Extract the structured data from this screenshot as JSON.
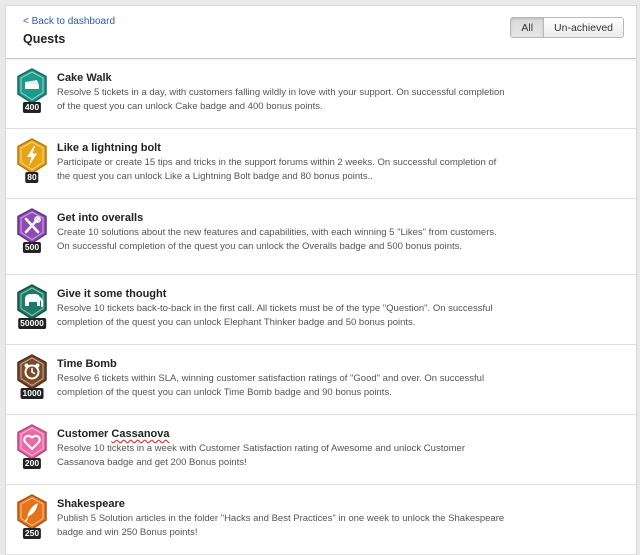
{
  "header": {
    "back_link": "< Back to dashboard",
    "title": "Quests",
    "filters": [
      {
        "label": "All",
        "active": true
      },
      {
        "label": "Un-achieved",
        "active": false
      }
    ]
  },
  "quests": [
    {
      "title": "Cake Walk",
      "title_tail": "",
      "points": "400",
      "icon": "cake-icon",
      "color": "#1f9a8a",
      "description": "Resolve 5 tickets in a day, with customers falling wildly in love with your support. On successful completion of the quest you can unlock Cake badge and 400 bonus points."
    },
    {
      "title": "Like a lightning bolt",
      "title_tail": "",
      "points": "80",
      "icon": "lightning-icon",
      "color": "#e8a317",
      "description": "Participate or create 15 tips and tricks in the support forums within 2 weeks. On successful completion of the quest you can unlock Like a Lightning Bolt badge and 80 bonus points.."
    },
    {
      "title": "Get into overalls",
      "title_tail": "",
      "points": "500",
      "icon": "tools-icon",
      "color": "#8e4bb5",
      "description": "Create 10 solutions about the new features and capabilities, with each winning 5 \"Likes\" from customers. On successful completion of the quest you can unlock the Overalls badge and 500 bonus points."
    },
    {
      "title": "Give it some thought",
      "title_tail": "",
      "points": "50000",
      "icon": "elephant-icon",
      "color": "#1d7a67",
      "description": "Resolve 10 tickets back-to-back in the first call. All tickets must be of the type \"Question\". On successful completion of the quest you can unlock Elephant Thinker badge and 50 bonus points."
    },
    {
      "title": "Time Bomb",
      "title_tail": "",
      "points": "1000",
      "icon": "alarm-clock-icon",
      "color": "#7a4a2a",
      "description": "Resolve 6 tickets within SLA, winning customer satisfaction ratings of \"Good\" and over. On successful completion of the quest you can unlock Time Bomb badge and 90 bonus points."
    },
    {
      "title": "Customer ",
      "title_tail": "Cassanova",
      "points": "200",
      "icon": "heart-icon",
      "color": "#e86aa6",
      "description": "Resolve 10 tickets in a week with Customer Satisfaction rating of Awesome and unlock Customer Cassanova badge and get 200 Bonus points!"
    },
    {
      "title": "Shakespeare",
      "title_tail": "",
      "points": "250",
      "icon": "quill-icon",
      "color": "#e5731c",
      "description": "Publish 5 Solution articles in the folder \"Hacks and Best Practices\" in one week to unlock the Shakespeare badge and win 250 Bonus points!"
    }
  ]
}
